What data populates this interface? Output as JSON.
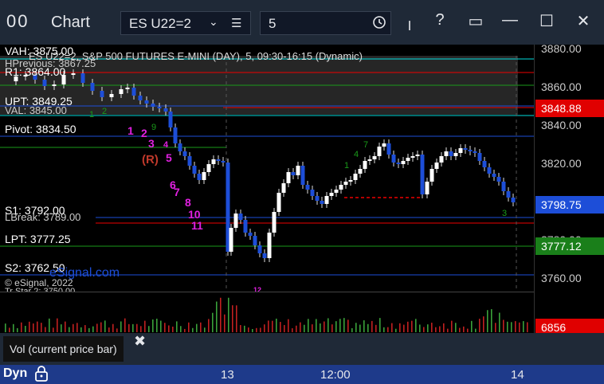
{
  "window": {
    "app_icon": "00",
    "title": "Chart",
    "symbol": "ES U22=2",
    "interval": "5",
    "buttons": [
      "pin-icon",
      "help-icon",
      "layout-icon",
      "minimize-icon",
      "maximize-icon",
      "close-icon"
    ],
    "help_label": "?"
  },
  "chart": {
    "header": "ES U22=2, S&P 500 FUTURES E-MINI (DAY), 5, 09:30-16:15 (Dynamic)",
    "copyright": "© eSignal, 2022",
    "watermark": "eSignal.com",
    "levels": {
      "vah": "VAH: 3875.00",
      "r1": "R1: 3864.00",
      "uprevious": "HPrevious: 3867.25",
      "upt": "UPT: 3849.25",
      "val": "VAL: 3845.00",
      "pivot": "Pivot: 3834.50",
      "s1": "S1: 3792.00",
      "lbreak": "LBreak: 3789.00",
      "lpt": "LPT: 3777.25",
      "s2": "S2: 3762.50",
      "trstar": "Tr Star 2: 3750.00"
    },
    "marker_r": "(R)",
    "count_labels": [
      "1",
      "2",
      "3",
      "4",
      "5",
      "6",
      "7",
      "8",
      "9",
      "10",
      "11",
      "12"
    ],
    "seq_labels": [
      "1",
      "2",
      "3",
      "4",
      "5",
      "6",
      "7",
      "8",
      "9"
    ]
  },
  "price_axis": {
    "ticks": [
      "3880.00",
      "3860.00",
      "3840.00",
      "3820.00",
      "3800.00",
      "3780.00",
      "3760.00"
    ],
    "tags": {
      "upt_tag": "3848.88",
      "last_tag": "3798.75",
      "lpt_tag": "3777.12",
      "vol_tag": "6856"
    },
    "colors": {
      "red": "#e00000",
      "blue": "#1d4ed8",
      "green": "#1a7f1a"
    }
  },
  "indicator": {
    "label": "Vol (current price bar)",
    "close": "✖"
  },
  "timebar": {
    "dyn": "Dyn",
    "ticks": [
      "13",
      "12:00",
      "14"
    ]
  }
}
